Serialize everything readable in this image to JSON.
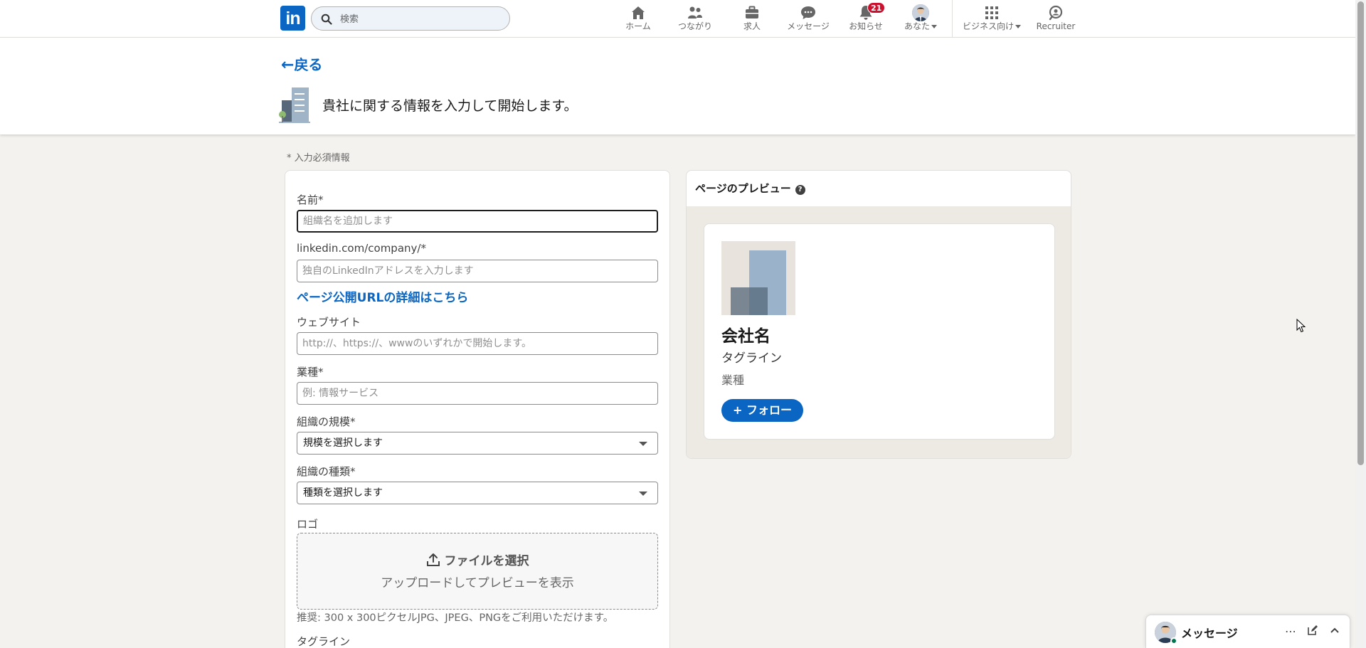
{
  "nav": {
    "logo_text": "in",
    "search_placeholder": "検索",
    "items": [
      {
        "label": "ホーム",
        "icon": "home-icon"
      },
      {
        "label": "つながり",
        "icon": "network-icon"
      },
      {
        "label": "求人",
        "icon": "briefcase-icon"
      },
      {
        "label": "メッセージ",
        "icon": "messaging-icon"
      },
      {
        "label": "お知らせ",
        "icon": "bell-icon",
        "badge": "21"
      },
      {
        "label": "あなた",
        "icon": "avatar"
      },
      {
        "label": "ビジネス向け",
        "icon": "grid-icon"
      },
      {
        "label": "Recruiter",
        "icon": "recruiter-icon"
      }
    ]
  },
  "header": {
    "back_label": "戻る",
    "title": "貴社に関する情報を入力して開始します。"
  },
  "form": {
    "required_note": "* 入力必須情報",
    "name_label": "名前*",
    "name_placeholder": "組織名を追加します",
    "url_label": "linkedin.com/company/*",
    "url_placeholder": "独自のLinkedInアドレスを入力します",
    "url_help_link": "ページ公開URLの詳細はこちら",
    "website_label": "ウェブサイト",
    "website_placeholder": "http://、https://、wwwのいずれかで開始します。",
    "industry_label": "業種*",
    "industry_placeholder": "例: 情報サービス",
    "size_label": "組織の規模*",
    "size_value": "規模を選択します",
    "type_label": "組織の種類*",
    "type_value": "種類を選択します",
    "logo_label": "ロゴ",
    "upload_button": "ファイルを選択",
    "upload_hint": "アップロードしてプレビューを表示",
    "upload_note": "推奨: 300 x 300ピクセルJPG、JPEG、PNGをご利用いただけます。",
    "tagline_label": "タグライン"
  },
  "preview": {
    "heading": "ページのプレビュー",
    "company_name": "会社名",
    "tagline": "タグライン",
    "industry": "業種",
    "follow_button": "+ フォロー"
  },
  "messaging": {
    "title": "メッセージ"
  },
  "colors": {
    "brand": "#0a66c2",
    "background": "#f4f2ee",
    "badge": "#cb112d"
  }
}
